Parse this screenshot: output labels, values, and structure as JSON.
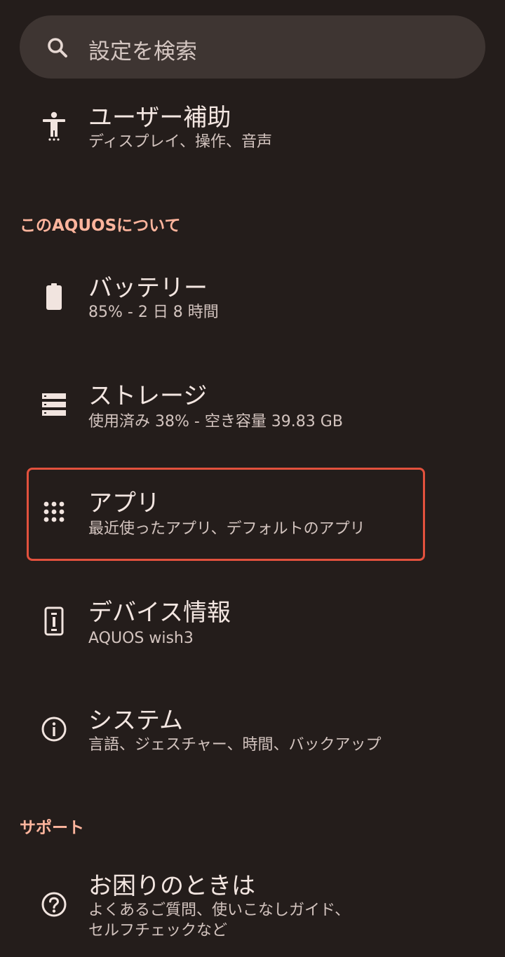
{
  "search": {
    "placeholder": "設定を検索",
    "icon": "search-icon"
  },
  "items_top": [
    {
      "id": "accessibility",
      "icon": "accessibility-icon",
      "title": "ユーザー補助",
      "subtitle": "ディスプレイ、操作、音声"
    }
  ],
  "section_about": {
    "label": "このAQUOSについて"
  },
  "items_about": [
    {
      "id": "battery",
      "icon": "battery-icon",
      "title": "バッテリー",
      "subtitle": "85% - 2 日 8 時間"
    },
    {
      "id": "storage",
      "icon": "storage-icon",
      "title": "ストレージ",
      "subtitle": "使用済み 38% - 空き容量 39.83 GB"
    },
    {
      "id": "apps",
      "icon": "apps-grid-icon",
      "title": "アプリ",
      "subtitle": "最近使ったアプリ、デフォルトのアプリ",
      "highlighted": true
    },
    {
      "id": "device-info",
      "icon": "device-info-icon",
      "title": "デバイス情報",
      "subtitle": "AQUOS wish3"
    },
    {
      "id": "system",
      "icon": "info-icon",
      "title": "システム",
      "subtitle": "言語、ジェスチャー、時間、バックアップ"
    }
  ],
  "section_support": {
    "label": "サポート"
  },
  "items_support": [
    {
      "id": "help",
      "icon": "help-icon",
      "title": "お困りのときは",
      "subtitle_line1": "よくあるご質問、使いこなしガイド、",
      "subtitle_line2": "セルフチェックなど"
    }
  ],
  "colors": {
    "background": "#241d1b",
    "search_bg": "#3e3532",
    "section_accent": "#ffb59d",
    "highlight_border": "#e2513d"
  }
}
